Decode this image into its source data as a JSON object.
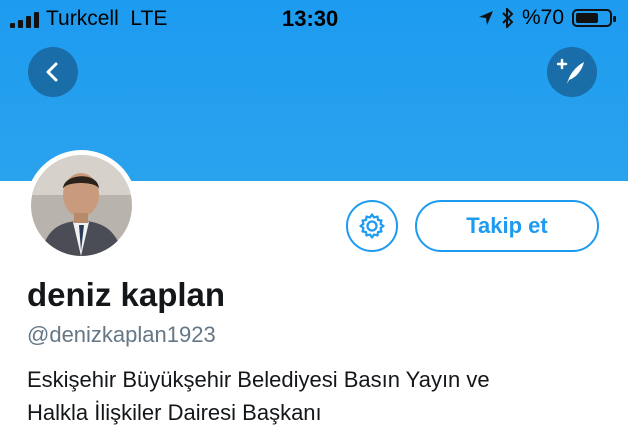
{
  "status_bar": {
    "carrier": "Turkcell",
    "network": "LTE",
    "time": "13:30",
    "battery_percent": "%70",
    "battery_level": 0.7
  },
  "header": {
    "background_color": "#1d9bf0",
    "back_icon": "chevron-left-icon",
    "compose_icon": "compose-feather-icon"
  },
  "profile": {
    "name": "deniz kaplan",
    "handle": "@denizkaplan1923",
    "bio_line1": "Eskişehir Büyükşehir Belediyesi Basın Yayın ve",
    "bio_line2": "Halkla İlişkiler Dairesi Başkanı"
  },
  "actions": {
    "settings_icon": "gear-icon",
    "follow_label": "Takip et",
    "accent_color": "#1d9bf0"
  }
}
